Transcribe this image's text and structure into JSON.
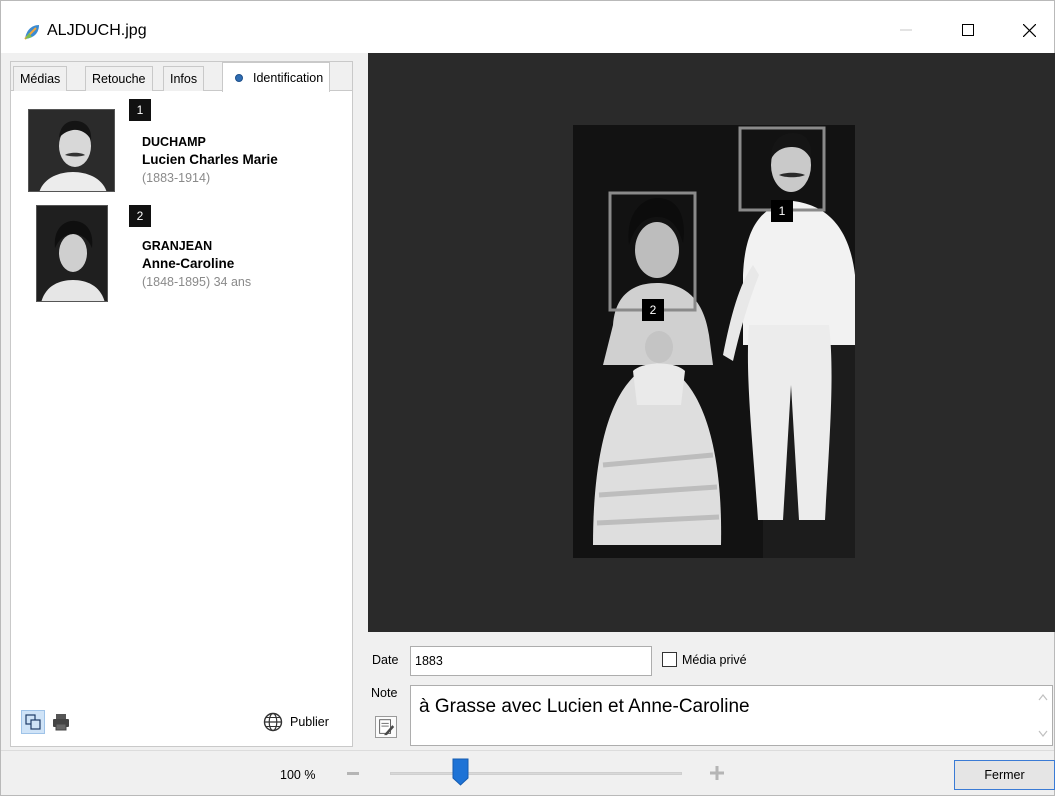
{
  "window": {
    "title": "ALJDUCH.jpg",
    "controls": {
      "minimize": "—",
      "maximize": "☐",
      "close": "✕"
    }
  },
  "tabs": [
    {
      "label": "Médias",
      "active": false
    },
    {
      "label": "Retouche",
      "active": false
    },
    {
      "label": "Infos",
      "active": false
    },
    {
      "label": "Identification",
      "active": true
    }
  ],
  "people": [
    {
      "number": "1",
      "last_name": "DUCHAMP",
      "first_names": "Lucien Charles Marie",
      "dates": "(1883-1914)"
    },
    {
      "number": "2",
      "last_name": "GRANJEAN",
      "first_names": "Anne-Caroline",
      "dates": "(1848-1895) 34 ans"
    }
  ],
  "left_toolbar": {
    "publish_label": "Publier"
  },
  "media_form": {
    "date_label": "Date",
    "date_value": "1883",
    "private_label": "Média privé",
    "private_checked": false,
    "note_label": "Note",
    "note_text": "à Grasse avec Lucien et Anne-Caroline"
  },
  "status": {
    "zoom_label": "100 %",
    "zoom_level_fraction": 0.22,
    "close_label": "Fermer"
  },
  "colors": {
    "accent": "#2f6db3",
    "viewer_background": "#2a2a2a",
    "badge": "#111111",
    "dates_text": "#8a8a8a"
  }
}
